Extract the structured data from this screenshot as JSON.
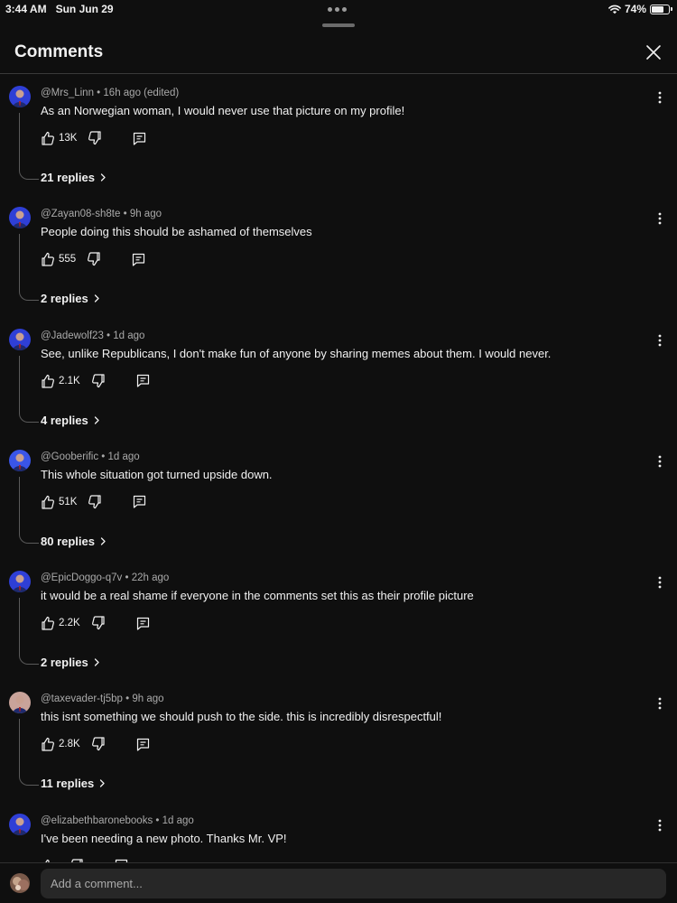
{
  "status_bar": {
    "time": "3:44 AM",
    "date": "Sun Jun 29",
    "battery": "74%",
    "battery_level": 0.74
  },
  "header": {
    "title": "Comments",
    "close_icon": "close-icon"
  },
  "comments": [
    {
      "author": "@Mrs_Linn",
      "age": "16h ago (edited)",
      "text": "As an Norwegian woman, I would never use that picture on my profile!",
      "likes": "13K",
      "replies": "21 replies",
      "avatar_color": "#2f3fd6"
    },
    {
      "author": "@Zayan08-sh8te",
      "age": "9h ago",
      "text": "People doing this should be ashamed of themselves",
      "likes": "555",
      "replies": "2 replies",
      "avatar_color": "#2f3fd6"
    },
    {
      "author": "@Jadewolf23",
      "age": "1d ago",
      "text": "See, unlike Republicans, I don't make fun of anyone by sharing memes about them. I would never.",
      "likes": "2.1K",
      "replies": "4 replies",
      "avatar_color": "#2f3fd6"
    },
    {
      "author": "@Gooberific",
      "age": "1d ago",
      "text": "This whole situation got turned upside down.",
      "likes": "51K",
      "replies": "80 replies",
      "avatar_color": "#3a55e8"
    },
    {
      "author": "@EpicDoggo-q7v",
      "age": "22h ago",
      "text": "it would be a real shame if everyone in the comments set this as their profile picture",
      "likes": "2.2K",
      "replies": "2 replies",
      "avatar_color": "#2f3fd6"
    },
    {
      "author": "@taxevader-tj5bp",
      "age": "9h ago",
      "text": "this isnt something we should push to the side. this is incredibly disrespectful!",
      "likes": "2.8K",
      "replies": "11 replies",
      "avatar_color": "#c9a39a"
    },
    {
      "author": "@elizabethbaronebooks",
      "age": "1d ago",
      "text": "I've been needing a new photo. Thanks Mr. VP!",
      "likes": "",
      "replies": "",
      "avatar_color": "#2f3fd6"
    }
  ],
  "composer": {
    "placeholder": "Add a comment..."
  },
  "colors": {
    "background": "#0f0f0f",
    "text": "#f1f1f1",
    "secondary_text": "#aaaaaa",
    "input_bg": "#272727"
  }
}
